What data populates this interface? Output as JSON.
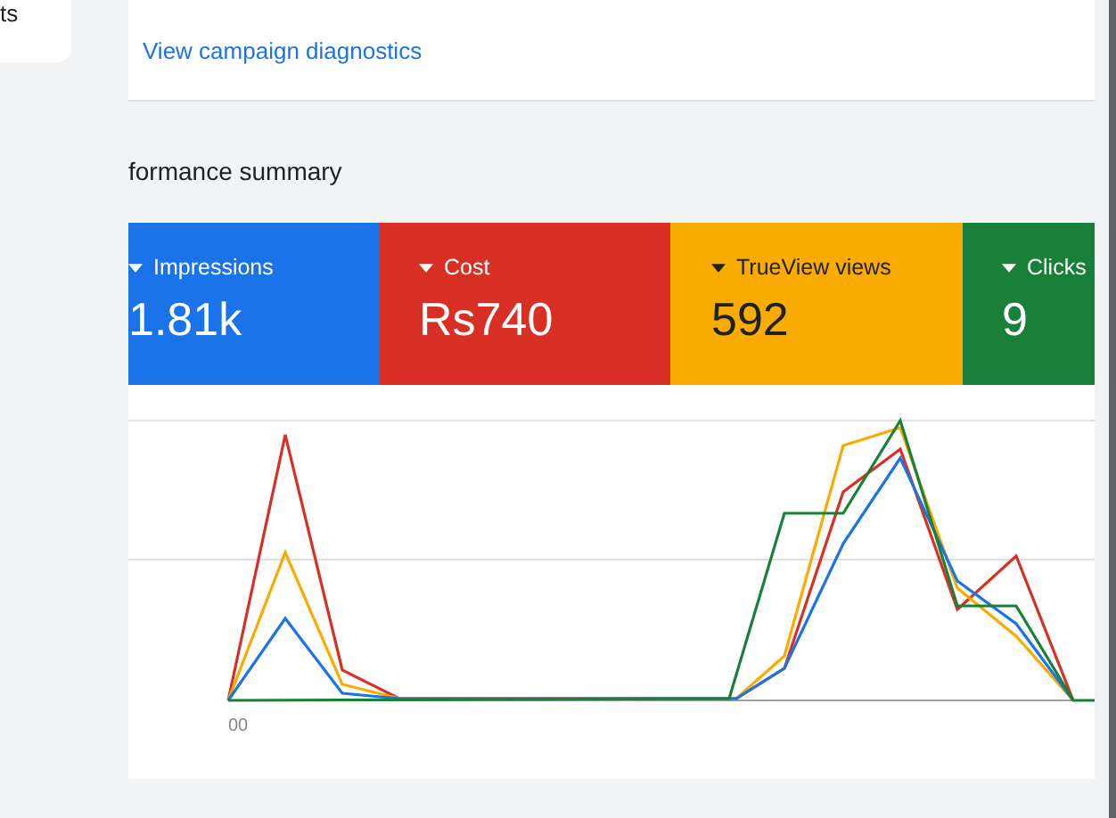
{
  "side_card": {
    "text": "ts"
  },
  "diagnostics": {
    "link": "View campaign diagnostics"
  },
  "section": {
    "title": "formance summary"
  },
  "metrics": [
    {
      "label": "Impressions",
      "value": "1.81k",
      "color": "#1a73e8",
      "dark_text": false
    },
    {
      "label": "Cost",
      "value": "Rs740",
      "color": "#d93025",
      "dark_text": false
    },
    {
      "label": "TrueView views",
      "value": "592",
      "color": "#f9ab00",
      "dark_text": true
    },
    {
      "label": "Clicks",
      "value": "9",
      "color": "#188038",
      "dark_text": false
    }
  ],
  "chart": {
    "x_label": "00"
  }
}
